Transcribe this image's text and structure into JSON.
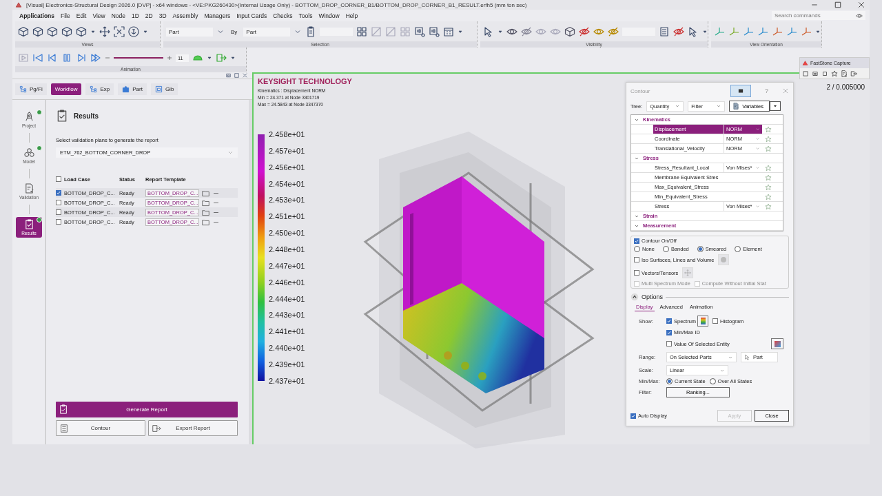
{
  "window": {
    "title": "[Visual] Electronics-Structural Design 2026.0 [DVP] - x64 windows - <VE:PKG260430>(Internal Usage Only) - BOTTOM_DROP_CORNER_B1/BOTTOM_DROP_CORNER_B1_RESULT.erfh5 (mm ton sec)"
  },
  "menu": [
    "Applications",
    "File",
    "Edit",
    "View",
    "Node",
    "1D",
    "2D",
    "3D",
    "Assembly",
    "Managers",
    "Input Cards",
    "Checks",
    "Tools",
    "Window",
    "Help"
  ],
  "search": {
    "placeholder": "Search commands"
  },
  "ribbon": {
    "groups": [
      "Views",
      "Selection",
      "Visibility",
      "View Orientation"
    ],
    "selection": {
      "filter": "Part",
      "by": "By",
      "target": "Part"
    }
  },
  "animation": {
    "label": "Animation",
    "level": 1,
    "frame": "11"
  },
  "capture_tool": {
    "title": "FastStone Capture"
  },
  "readout": "2 / 0.005000",
  "left_panel": {
    "tabs": [
      {
        "label": "Pg/Fl",
        "selected": false
      },
      {
        "label": "Workflow",
        "selected": true
      },
      {
        "label": "Exp",
        "selected": false
      },
      {
        "label": "Part",
        "selected": false
      },
      {
        "label": "Glb",
        "selected": false
      }
    ],
    "steps": [
      {
        "label": "Project",
        "done": true,
        "selected": false
      },
      {
        "label": "Model",
        "done": true,
        "selected": false
      },
      {
        "label": "Validation",
        "done": false,
        "selected": false
      },
      {
        "label": "Results",
        "done": true,
        "selected": true
      }
    ],
    "section_title": "Results",
    "prompt": "Select validation plans to generate the report",
    "plan": "ETM_762_BOTTOM_CORNER_DROP",
    "select_all": false,
    "columns": [
      "Load Case",
      "Status",
      "Report Template"
    ],
    "rows": [
      {
        "load_case": "BOTTOM_DROP_C...",
        "status": "Ready",
        "template": "BOTTOM_DROP_C...",
        "checked": true
      },
      {
        "load_case": "BOTTOM_DROP_C...",
        "status": "Ready",
        "template": "BOTTOM_DROP_C...",
        "checked": false
      },
      {
        "load_case": "BOTTOM_DROP_C...",
        "status": "Ready",
        "template": "BOTTOM_DROP_C...",
        "checked": false
      },
      {
        "load_case": "BOTTOM_DROP_C...",
        "status": "Ready",
        "template": "BOTTOM_DROP_C...",
        "checked": false
      }
    ],
    "buttons": [
      {
        "label": "Generate Report",
        "kind": "primary"
      },
      {
        "label": "Contour",
        "kind": "secondary"
      },
      {
        "label": "Export Report",
        "kind": "secondary"
      }
    ]
  },
  "viewport": {
    "brand": "KEYSIGHT TECHNOLOGY",
    "info": [
      "Kinematics : Displacement NORM",
      "Min = 24.371 at Node 3301719",
      "Max = 24.5843 at Node 3347370"
    ],
    "legend": [
      "2.458e+01",
      "2.457e+01",
      "2.456e+01",
      "2.454e+01",
      "2.453e+01",
      "2.451e+01",
      "2.450e+01",
      "2.448e+01",
      "2.447e+01",
      "2.446e+01",
      "2.444e+01",
      "2.443e+01",
      "2.441e+01",
      "2.440e+01",
      "2.439e+01",
      "2.437e+01"
    ]
  },
  "contour": {
    "title": "Contour",
    "help": "?",
    "tree_label": "Tree:",
    "tree_mode": "Quantity",
    "filter": "Filter",
    "variables": "Variables",
    "groups": [
      {
        "name": "Kinematics",
        "expanded": true,
        "items": [
          {
            "name": "Displacement",
            "component": "NORM",
            "selected": true
          },
          {
            "name": "Coordinate",
            "component": "NORM",
            "selected": false
          },
          {
            "name": "Translational_Velocity",
            "component": "NORM",
            "selected": false
          }
        ]
      },
      {
        "name": "Stress",
        "expanded": true,
        "items": [
          {
            "name": "Stress_Resultant_Local",
            "component": "Von Mises*",
            "selected": false
          },
          {
            "name": "Membrane Equivalent Stres",
            "selected": false
          },
          {
            "name": "Max_Equivalent_Stress",
            "selected": false
          },
          {
            "name": "Min_Equivalent_Stress",
            "selected": false
          },
          {
            "name": "Stress",
            "component": "Von Mises*",
            "selected": false
          }
        ]
      },
      {
        "name": "Strain",
        "expanded": true
      },
      {
        "name": "Measurement",
        "expanded": true
      }
    ],
    "contour_toggle": {
      "label": "Contour On/Off",
      "checked": true
    },
    "modes": [
      {
        "label": "None",
        "selected": false
      },
      {
        "label": "Banded",
        "selected": false
      },
      {
        "label": "Smeared",
        "selected": true
      },
      {
        "label": "Element",
        "selected": false
      }
    ],
    "iso": {
      "label": "Iso Surfaces, Lines and Volume",
      "checked": false
    },
    "vectors": {
      "label": "Vectors/Tensors",
      "checked": false
    },
    "extras": [
      {
        "label": "Multi Spectrum Mode",
        "checked": false,
        "disabled": true
      },
      {
        "label": "Compute Without Initial Stat",
        "checked": false,
        "disabled": true
      }
    ],
    "options_title": "Options",
    "option_tabs": [
      {
        "label": "Display",
        "selected": true
      },
      {
        "label": "Advanced",
        "selected": false
      },
      {
        "label": "Animation",
        "selected": false
      }
    ],
    "show_label": "Show:",
    "spectrum": {
      "label": "Spectrum",
      "checked": true
    },
    "histogram": {
      "label": "Histogram",
      "checked": false
    },
    "minmax_id": {
      "label": "Min/Max ID",
      "checked": true
    },
    "value_selected": {
      "label": "Value Of Selected Entity",
      "checked": false
    },
    "range_label": "Range:",
    "range": "On Selected Parts",
    "range_pick": "Part",
    "scale_label": "Scale:",
    "scale": "Linear",
    "minmax_label": "Min/Max:",
    "minmax_modes": [
      {
        "label": "Current State",
        "selected": true
      },
      {
        "label": "Over All States",
        "selected": false
      }
    ],
    "filter_label": "Filter:",
    "ranking": "Ranking...",
    "auto_display": {
      "label": "Auto Display",
      "checked": true
    },
    "apply": {
      "label": "Apply",
      "disabled": true
    },
    "close": {
      "label": "Close"
    }
  }
}
